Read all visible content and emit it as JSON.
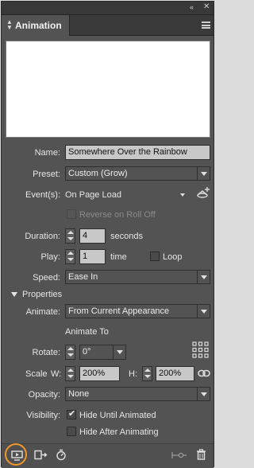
{
  "panel": {
    "collapse_glyph": "‹‹",
    "close_glyph": "✕",
    "tab_title": "Animation"
  },
  "form": {
    "name_label": "Name:",
    "name_value": "Somewhere Over the Rainbow",
    "preset_label": "Preset:",
    "preset_value": "Custom (Grow)",
    "events_label": "Event(s):",
    "events_value": "On Page Load",
    "reverse_label": "Reverse on Roll Off",
    "duration_label": "Duration:",
    "duration_value": "4",
    "duration_unit": "seconds",
    "play_label": "Play:",
    "play_value": "1",
    "play_unit": "time",
    "loop_label": "Loop",
    "speed_label": "Speed:",
    "speed_value": "Ease In"
  },
  "properties": {
    "section_label": "Properties",
    "animate_label": "Animate:",
    "animate_value": "From Current Appearance",
    "animate_to_label": "Animate To",
    "rotate_label": "Rotate:",
    "rotate_value": "0°",
    "scale_label": "Scale",
    "w_label": "W:",
    "w_value": "200%",
    "h_label": "H:",
    "h_value": "200%",
    "opacity_label": "Opacity:",
    "opacity_value": "None",
    "visibility_label": "Visibility:",
    "hide_until_label": "Hide Until Animated",
    "hide_after_label": "Hide After Animating"
  },
  "state": {
    "reverse_checked": false,
    "loop_checked": false,
    "hide_until_checked": true,
    "hide_after_checked": false
  },
  "colors": {
    "panel_bg": "#535353",
    "field_bg": "#c8c8c8",
    "highlight_ring": "#f0962a"
  },
  "icons": [
    "preview-icon",
    "proxy-icon",
    "timing-icon",
    "convert-icon",
    "trash-icon",
    "add-event-icon",
    "link-icon",
    "reference-point-icon"
  ]
}
